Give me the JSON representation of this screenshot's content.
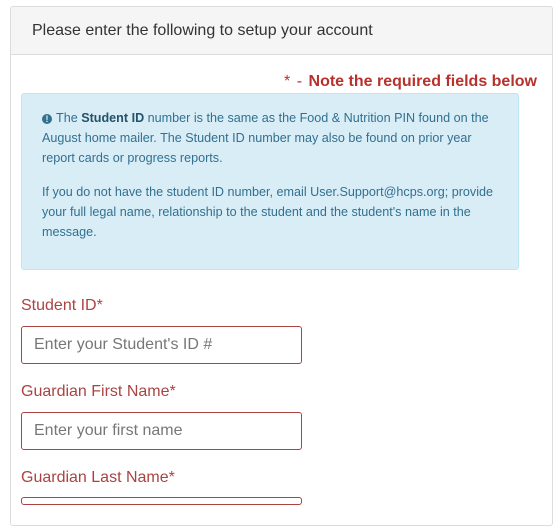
{
  "panel": {
    "heading": "Please enter the following to setup your account"
  },
  "required_note": {
    "star": "*",
    "dash": "-",
    "text": "Note the required fields below"
  },
  "info": {
    "p1_prefix": "The ",
    "p1_bold": "Student ID",
    "p1_rest": " number is the same as the Food & Nutrition PIN found on the August home mailer. The Student ID number may also be found on prior year report cards or progress reports.",
    "p2": "If you do not have the student ID number, email User.Support@hcps.org; provide your full legal name, relationship to the student and the student's name in the message."
  },
  "form": {
    "student_id": {
      "label": "Student ID*",
      "placeholder": "Enter your Student's ID #",
      "value": ""
    },
    "guardian_first": {
      "label": "Guardian First Name*",
      "placeholder": "Enter your first name",
      "value": ""
    },
    "guardian_last": {
      "label": "Guardian Last Name*",
      "placeholder": "",
      "value": ""
    }
  },
  "colors": {
    "error": "#a94442",
    "info_bg": "#d9edf7",
    "info_text": "#31708f"
  },
  "icons": {
    "info": "info-circle-icon"
  }
}
